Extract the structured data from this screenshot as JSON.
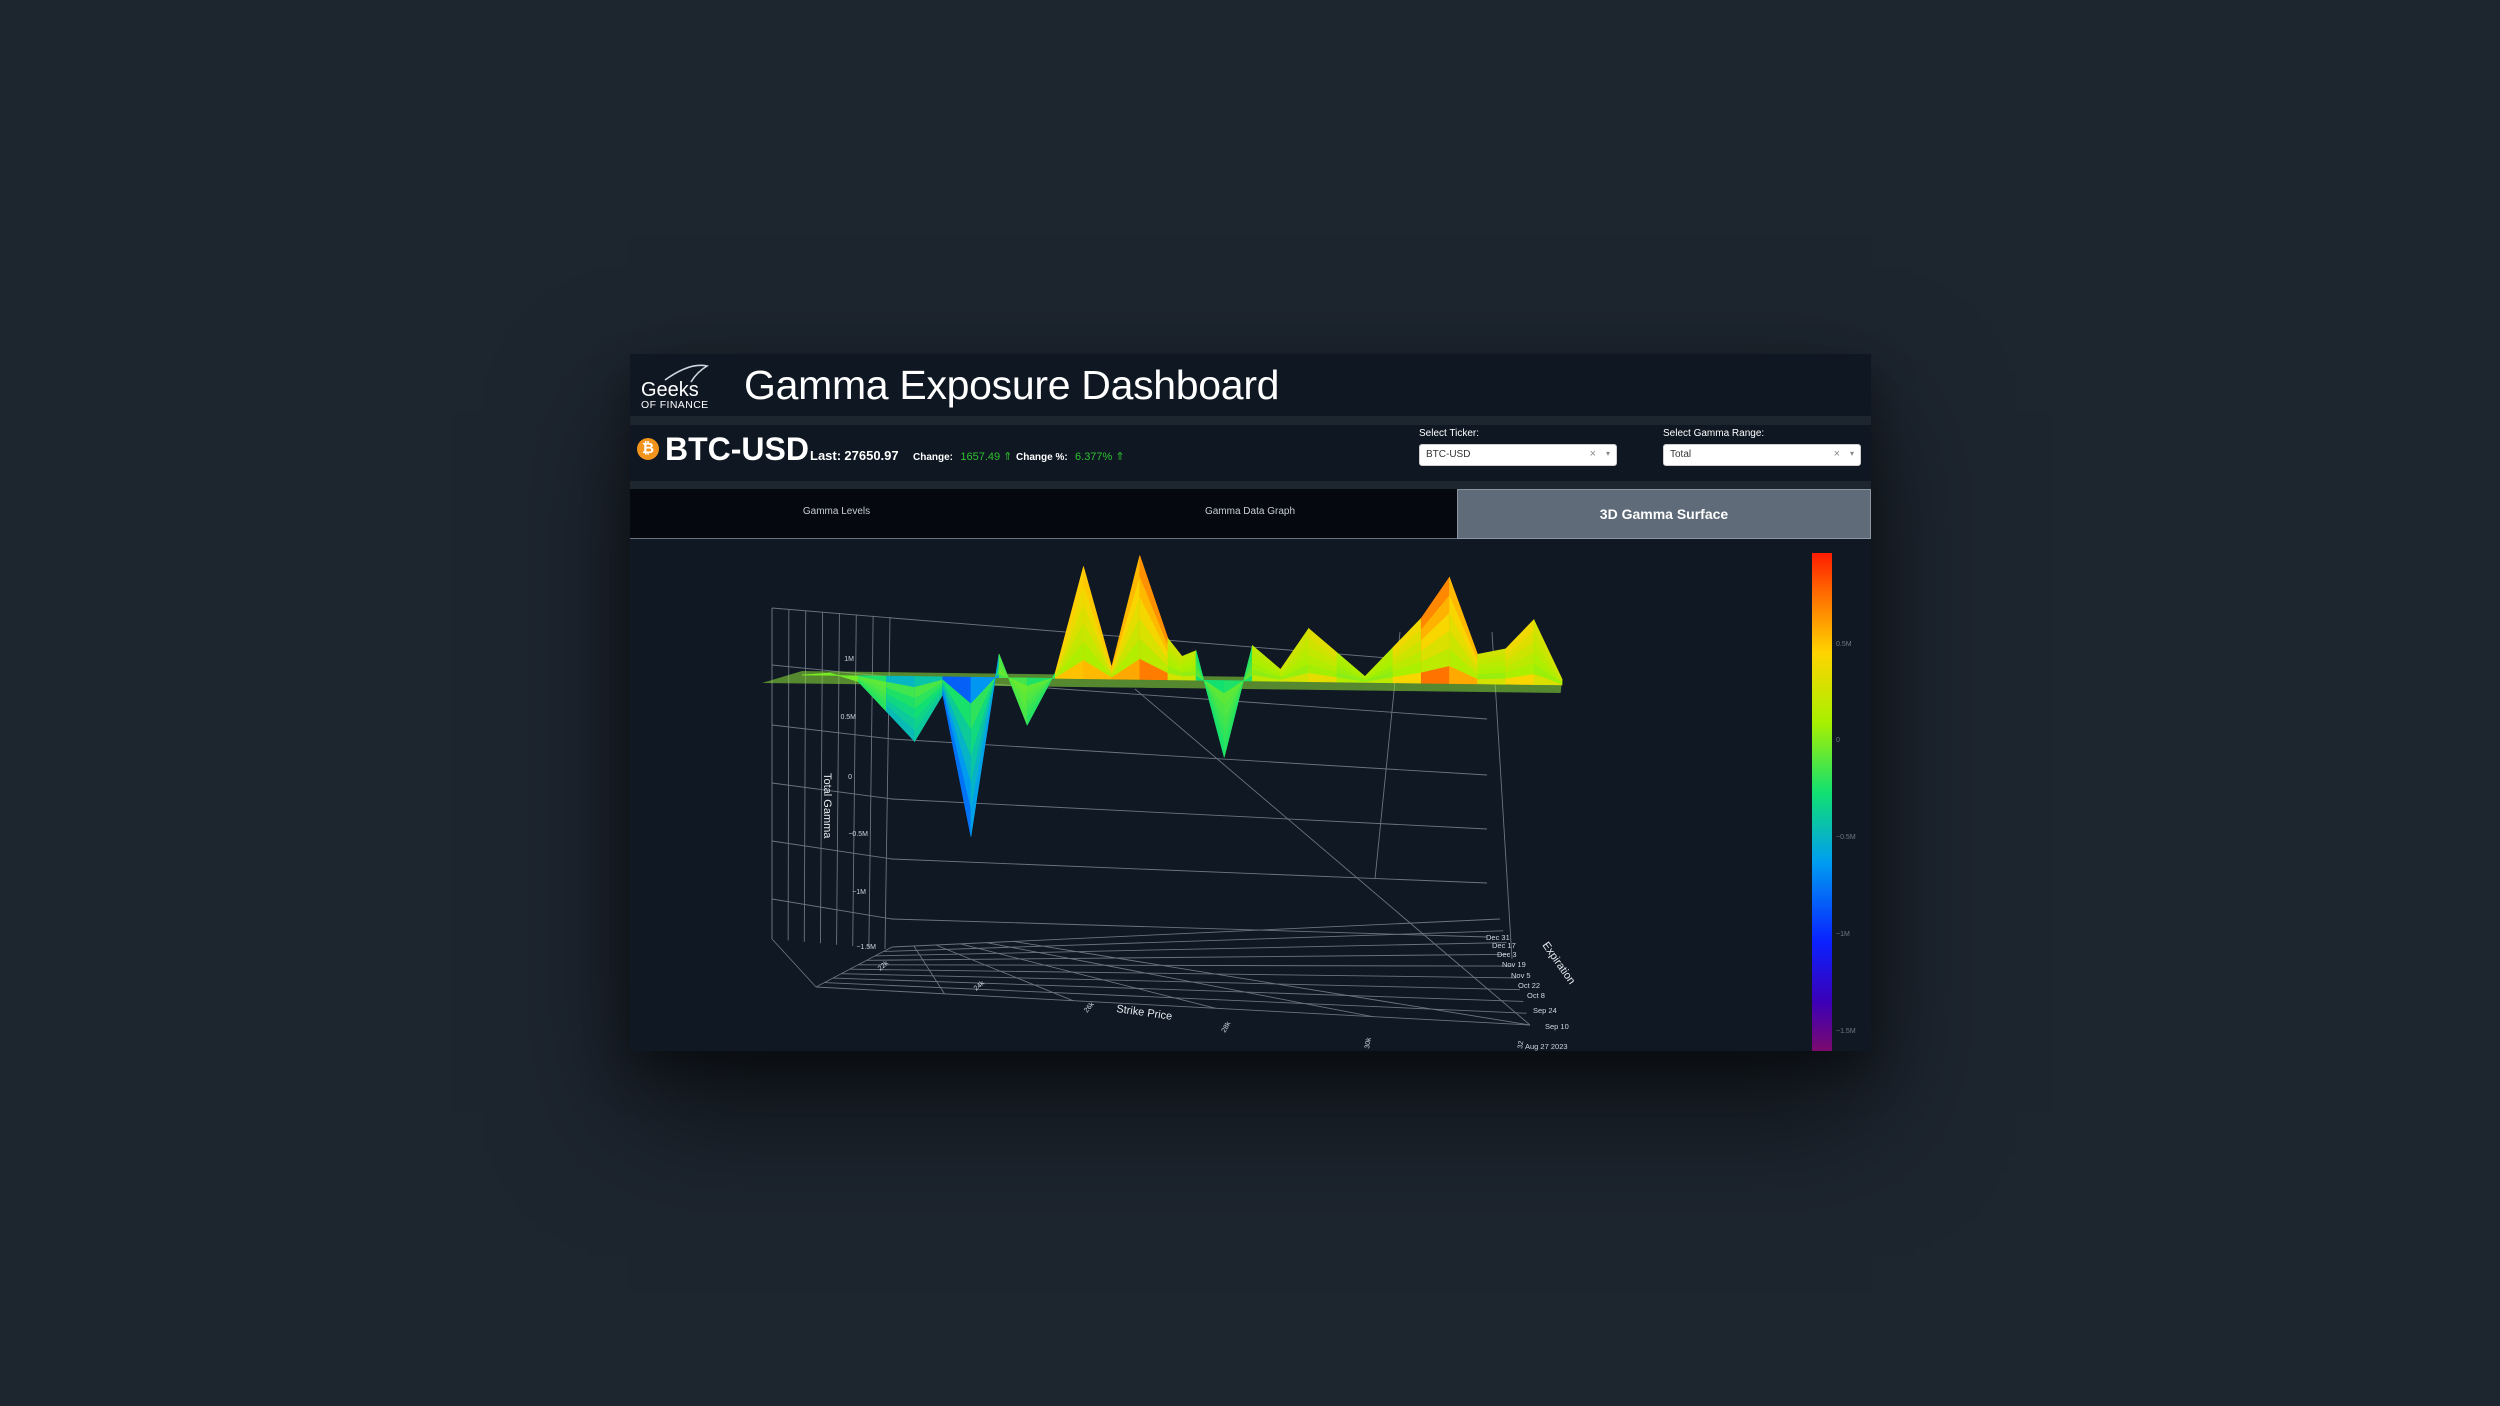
{
  "header": {
    "logo_text_top": "Geeks",
    "logo_text_bottom": "OF FINANCE",
    "title": "Gamma Exposure Dashboard"
  },
  "ticker": {
    "coin_glyph": "₿",
    "symbol": "BTC-USD",
    "last_label": "Last:",
    "last_value": "27650.97",
    "change_label": "Change:",
    "change_value": "1657.49 ⇑",
    "change_pct_label": "Change %:",
    "change_pct_value": "6.377% ⇑",
    "positive_color": "#2fc12f"
  },
  "controls": {
    "ticker_select": {
      "label": "Select Ticker:",
      "value": "BTC-USD",
      "clear": "×",
      "arrow": "▾"
    },
    "range_select": {
      "label": "Select Gamma Range:",
      "value": "Total",
      "clear": "×",
      "arrow": "▾"
    }
  },
  "tabs": [
    {
      "label": "Gamma Levels",
      "active": false
    },
    {
      "label": "Gamma Data Graph",
      "active": false
    },
    {
      "label": "3D Gamma Surface",
      "active": true
    }
  ],
  "chart_data": {
    "type": "surface",
    "title": "",
    "z_axis": {
      "label": "Total Gamma",
      "ticks": [
        "1M",
        "0.5M",
        "0",
        "−0.5M",
        "−1M",
        "−1.5M"
      ]
    },
    "x_axis": {
      "label": "Strike Price",
      "ticks": [
        "22k",
        "24k",
        "26k",
        "28k",
        "30k",
        "32"
      ]
    },
    "y_axis": {
      "label": "Expiration",
      "ticks": [
        "Aug 27 2023",
        "Sep 10",
        "Sep 24",
        "Oct 8",
        "Oct 22",
        "Nov 5",
        "Nov 19",
        "Dec 3",
        "Dec 17",
        "Dec 31"
      ]
    },
    "colorbar": {
      "ticks": [
        "0.5M",
        "0",
        "−0.5M",
        "−1M",
        "−1.5M"
      ],
      "range": [
        -1.5,
        1
      ]
    },
    "profile": {
      "strike": [
        21600,
        22000,
        22400,
        22800,
        23200,
        23600,
        24000,
        24400,
        24800,
        25200,
        25600,
        26000,
        26400,
        26800,
        27000,
        27200,
        27600,
        28000,
        28400,
        28800,
        29200,
        29600,
        30000,
        30400,
        30800,
        31200,
        31600,
        32000,
        32400
      ],
      "gamma_millions": [
        0,
        0.02,
        -0.05,
        -0.3,
        -0.55,
        -0.15,
        -1.35,
        0.2,
        -0.4,
        0.05,
        0.95,
        0.1,
        1.05,
        0.35,
        0.2,
        0.25,
        -0.65,
        0.3,
        0.1,
        0.45,
        0.25,
        0.05,
        0.3,
        0.55,
        0.9,
        0.25,
        0.3,
        0.55,
        0.05
      ]
    }
  }
}
